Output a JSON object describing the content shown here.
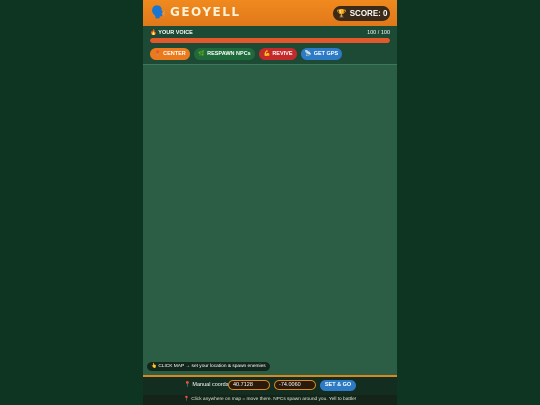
{
  "header": {
    "logo_icon": "🗣️",
    "title": "GEOYELL",
    "score_icon": "🏆",
    "score_label": "SCORE: 0"
  },
  "voice": {
    "icon": "🔥",
    "label": "YOUR VOICE",
    "value_text": "100 / 100",
    "level": 1.0
  },
  "buttons": {
    "center": {
      "icon": "📍",
      "label": "CENTER"
    },
    "respawn": {
      "icon": "🌿",
      "label": "RESPAWN NPCs"
    },
    "revive": {
      "icon": "💪",
      "label": "REVIVE"
    },
    "gps": {
      "icon": "📡",
      "label": "GET GPS"
    }
  },
  "map": {
    "hint_icon": "👆",
    "hint": "CLICK MAP → set your location & spawn enemies"
  },
  "coords": {
    "icon": "📍",
    "label": "Manual coords:",
    "lat": "40.7128",
    "lng": "-74.0060",
    "go_label": "SET & GO"
  },
  "footer": {
    "icon": "📍",
    "text": "Click anywhere on map = move there. NPCs spawn around you. Yell to battle!"
  },
  "colors": {
    "accent": "#f08a1e",
    "map": "#2b5e45",
    "health": "#e25a2c"
  }
}
